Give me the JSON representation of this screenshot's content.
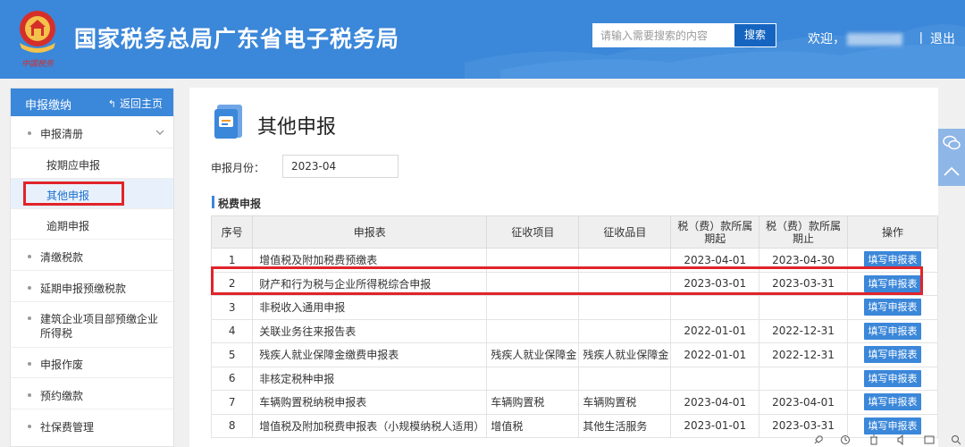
{
  "header": {
    "title": "国家税务总局广东省电子税务局",
    "emblem_caption": "中国税务",
    "search_placeholder": "请输入需要搜索的内容",
    "search_button": "搜索",
    "welcome": "欢迎，",
    "separator": "|",
    "logout": "退出"
  },
  "sidebar": {
    "title": "申报缴纳",
    "back_label": "返回主页",
    "back_icon": "back-arrow-icon",
    "menu": [
      {
        "label": "申报清册",
        "expanded": true
      },
      {
        "label": "清缴税款"
      },
      {
        "label": "延期申报预缴税款"
      },
      {
        "label": "建筑企业项目部预缴企业",
        "label2": "所得税"
      },
      {
        "label": "申报作废"
      },
      {
        "label": "预约缴款"
      },
      {
        "label": "社保费管理"
      }
    ],
    "submenu": [
      {
        "label": "按期应申报"
      },
      {
        "label": "其他申报",
        "active": true
      },
      {
        "label": "逾期申报"
      }
    ]
  },
  "main": {
    "page_title": "其他申报",
    "month_label": "申报月份：",
    "month_value": "2023-04",
    "section_title": "税费申报",
    "columns": [
      "序号",
      "申报表",
      "征收项目",
      "征收品目",
      "税（费）款所属期起",
      "税（费）款所属期止",
      "操作"
    ],
    "action_label": "填写申报表",
    "rows": [
      {
        "no": "1",
        "name": "增值税及附加税费预缴表",
        "item": "",
        "subitem": "",
        "start": "2023-04-01",
        "end": "2023-04-30"
      },
      {
        "no": "2",
        "name": "财产和行为税与企业所得税综合申报",
        "item": "",
        "subitem": "",
        "start": "2023-03-01",
        "end": "2023-03-31"
      },
      {
        "no": "3",
        "name": "非税收入通用申报",
        "item": "",
        "subitem": "",
        "start": "",
        "end": ""
      },
      {
        "no": "4",
        "name": "关联业务往来报告表",
        "item": "",
        "subitem": "",
        "start": "2022-01-01",
        "end": "2022-12-31"
      },
      {
        "no": "5",
        "name": "残疾人就业保障金缴费申报表",
        "item": "残疾人就业保障金",
        "subitem": "残疾人就业保障金",
        "start": "2022-01-01",
        "end": "2022-12-31"
      },
      {
        "no": "6",
        "name": "非核定税种申报",
        "item": "",
        "subitem": "",
        "start": "",
        "end": ""
      },
      {
        "no": "7",
        "name": "车辆购置税纳税申报表",
        "item": "车辆购置税",
        "subitem": "车辆购置税",
        "start": "2023-04-01",
        "end": "2023-04-01"
      },
      {
        "no": "8",
        "name": "增值税及附加税费申报表（小规模纳税人适用）",
        "item": "增值税",
        "subitem": "其他生活服务",
        "start": "2023-01-01",
        "end": "2023-03-31"
      }
    ]
  },
  "colors": {
    "brand_blue": "#3b87d9",
    "highlight_red": "#e0242a",
    "button_blue": "#1565c0"
  },
  "floating": [
    "chat-bubble-icon",
    "scroll-top-icon"
  ]
}
